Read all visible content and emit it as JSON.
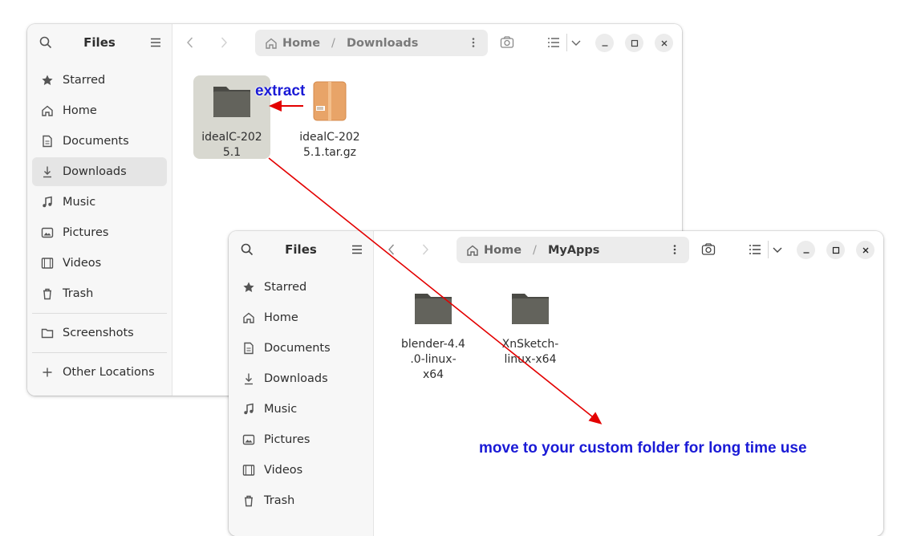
{
  "window_back": {
    "sidebar": {
      "title": "Files",
      "items": [
        {
          "label": "Starred"
        },
        {
          "label": "Home"
        },
        {
          "label": "Documents"
        },
        {
          "label": "Downloads"
        },
        {
          "label": "Music"
        },
        {
          "label": "Pictures"
        },
        {
          "label": "Videos"
        },
        {
          "label": "Trash"
        },
        {
          "label": "Screenshots"
        },
        {
          "label": "Other Locations"
        }
      ]
    },
    "path": {
      "root": "Home",
      "separator": "/",
      "current": "Downloads"
    },
    "files": [
      {
        "name": "idealC-202\n5.1",
        "type": "folder",
        "selected": true
      },
      {
        "name": "idealC-202\n5.1.tar.gz",
        "type": "archive"
      }
    ]
  },
  "window_front": {
    "sidebar": {
      "title": "Files",
      "items": [
        {
          "label": "Starred"
        },
        {
          "label": "Home"
        },
        {
          "label": "Documents"
        },
        {
          "label": "Downloads"
        },
        {
          "label": "Music"
        },
        {
          "label": "Pictures"
        },
        {
          "label": "Videos"
        },
        {
          "label": "Trash"
        }
      ]
    },
    "path": {
      "root": "Home",
      "separator": "/",
      "current": "MyApps"
    },
    "files": [
      {
        "name": "blender-4.4\n.0-linux-\nx64",
        "type": "folder"
      },
      {
        "name": "XnSketch-\nlinux-x64",
        "type": "folder"
      }
    ]
  },
  "annotations": {
    "extract": "extract",
    "move": "move to your custom folder for long time use"
  },
  "colors": {
    "arrow": "#e30000",
    "annotation_text": "#1a1ad6",
    "folder": "#5e5e58",
    "archive": "#e8a468",
    "selection": "#d8d8d0"
  }
}
